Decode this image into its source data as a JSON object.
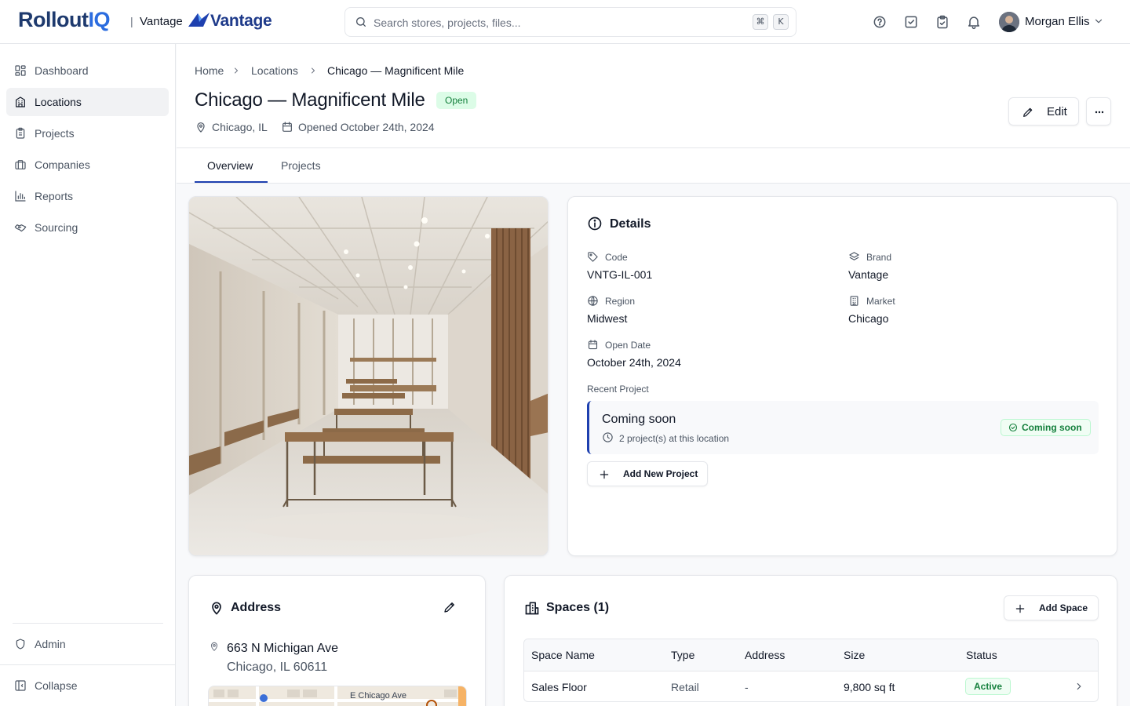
{
  "topbar": {
    "logo_main": "Rollout",
    "logo_accent": "IQ",
    "org_separator": "|",
    "org_name": "Vantage",
    "brand_name": "Vantage",
    "search_placeholder": "Search stores, projects, files...",
    "shortcut_keys": [
      "⌘",
      "K"
    ],
    "icons": [
      "help-icon",
      "checkbox-icon",
      "clipboard-check-icon",
      "bell-icon"
    ],
    "user_name": "Morgan Ellis"
  },
  "sidebar": {
    "items": [
      {
        "label": "Dashboard",
        "icon": "dashboard-icon",
        "active": false
      },
      {
        "label": "Locations",
        "icon": "building-icon",
        "active": true
      },
      {
        "label": "Projects",
        "icon": "clipboard-icon",
        "active": false
      },
      {
        "label": "Companies",
        "icon": "briefcase-icon",
        "active": false
      },
      {
        "label": "Reports",
        "icon": "bar-chart-icon",
        "active": false
      },
      {
        "label": "Sourcing",
        "icon": "handshake-icon",
        "active": false
      }
    ],
    "admin_label": "Admin",
    "collapse_label": "Collapse"
  },
  "breadcrumb": [
    "Home",
    "Locations",
    "Chicago — Magnificent Mile"
  ],
  "page": {
    "title": "Chicago — Magnificent Mile",
    "status": "Open",
    "city": "Chicago, IL",
    "opened": "Opened October 24th, 2024",
    "edit_label": "Edit"
  },
  "tabs": [
    {
      "label": "Overview",
      "active": true
    },
    {
      "label": "Projects",
      "active": false
    }
  ],
  "details": {
    "title": "Details",
    "fields": [
      {
        "label": "Code",
        "value": "VNTG-IL-001",
        "icon": "tag-icon"
      },
      {
        "label": "Brand",
        "value": "Vantage",
        "icon": "layers-icon"
      },
      {
        "label": "Region",
        "value": "Midwest",
        "icon": "globe-icon"
      },
      {
        "label": "Market",
        "value": "Chicago",
        "icon": "building-icon"
      },
      {
        "label": "Open Date",
        "value": "October 24th, 2024",
        "icon": "calendar-icon"
      }
    ],
    "recent_label": "Recent Project",
    "recent_title": "Coming soon",
    "recent_sub": "2 project(s) at this location",
    "recent_badge": "Coming soon",
    "add_project_label": "Add New Project"
  },
  "address": {
    "title": "Address",
    "line1": "663 N Michigan Ave",
    "line2": "Chicago, IL 60611",
    "map_street": "E Chicago Ave"
  },
  "spaces": {
    "title": "Spaces (1)",
    "add_label": "Add Space",
    "columns": [
      "Space Name",
      "Type",
      "Address",
      "Size",
      "Status"
    ],
    "rows": [
      {
        "name": "Sales Floor",
        "type": "Retail",
        "address": "-",
        "size": "9,800 sq ft",
        "status": "Active"
      }
    ]
  },
  "colors": {
    "brand_dark": "#1e3a6e",
    "brand_accent": "#2b6cdf",
    "tab_underline": "#1e40af",
    "success_text": "#15803d",
    "success_bg": "#dcfce7"
  }
}
